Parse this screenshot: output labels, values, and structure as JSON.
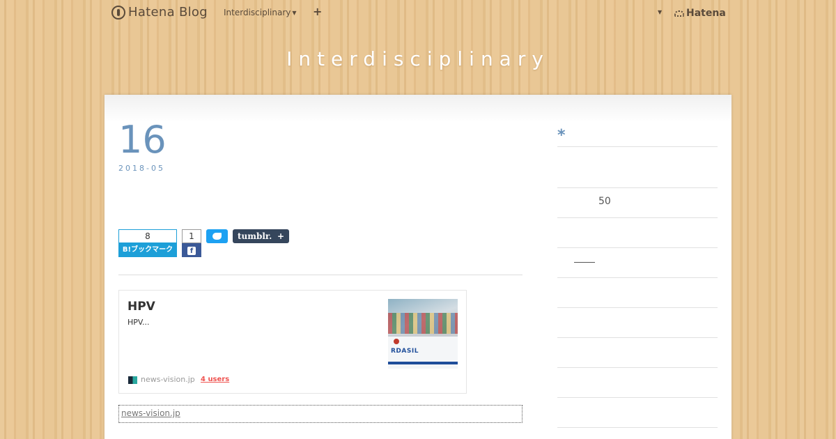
{
  "global_header": {
    "logo_text": "Hatena Blog",
    "blog_menu_label": "Interdisciplinary",
    "add_label": "+",
    "hatena_label": "Hatena"
  },
  "blog": {
    "title": "Interdisciplinary"
  },
  "entry": {
    "day": "16",
    "year_month": "2018-05"
  },
  "share": {
    "hatena_bookmark_count": "8",
    "hatena_bookmark_label": "B!ブックマーク",
    "facebook_count": "1",
    "tumblr_label": "tumblr.",
    "tumblr_plus": "+"
  },
  "embed": {
    "title": "HPV",
    "description": "HPV...",
    "thumb_text": "RDASIL",
    "site": "news-vision.jp",
    "users": "4 users"
  },
  "source_link": "news-vision.jp",
  "sidebar": {
    "asterisk": "*",
    "number_text": "50"
  },
  "colors": {
    "accent_blue": "#6a93bb",
    "hatena_blue": "#1d9fd8",
    "facebook": "#3b5998",
    "twitter": "#1da1f2",
    "tumblr": "#35465c",
    "users_red": "#ef5350"
  }
}
